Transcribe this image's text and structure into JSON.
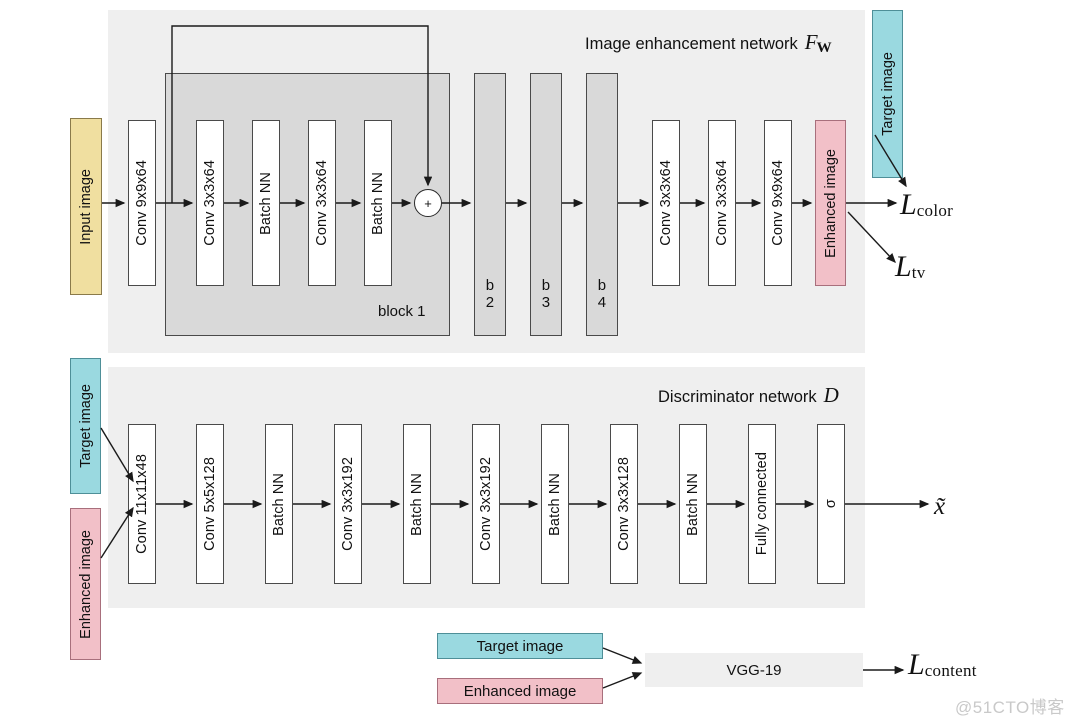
{
  "figure": {
    "enhancement_caption": "Image enhancement network",
    "enhancement_symbol": "F",
    "enhancement_symbol_sub": "W",
    "discriminator_caption": "Discriminator network",
    "discriminator_symbol": "D",
    "block1_label": "block 1"
  },
  "io": {
    "input_image": "Input image",
    "target_image": "Target image",
    "enhanced_image": "Enhanced image",
    "target_image_top": "Target image",
    "target_image_disc": "Target image",
    "enhanced_image_disc": "Enhanced image",
    "target_image_vgg": "Target image",
    "enhanced_image_vgg": "Enhanced image"
  },
  "enhancement_layers": [
    {
      "label": "Conv 9x9x64",
      "kind": "white"
    },
    {
      "label": "Conv 3x3x64",
      "kind": "white"
    },
    {
      "label": "Batch NN",
      "kind": "white"
    },
    {
      "label": "Conv 3x3x64",
      "kind": "white"
    },
    {
      "label": "Batch NN",
      "kind": "white"
    },
    {
      "label": "Conv 3x3x64",
      "kind": "white"
    },
    {
      "label": "Conv 3x3x64",
      "kind": "white"
    },
    {
      "label": "Conv 9x9x64",
      "kind": "white"
    }
  ],
  "residual_blocks": [
    {
      "top": "b",
      "bottom": "2"
    },
    {
      "top": "b",
      "bottom": "3"
    },
    {
      "top": "b",
      "bottom": "4"
    }
  ],
  "adder": {
    "symbol": "+"
  },
  "discriminator_layers": [
    {
      "label": "Conv 11x11x48"
    },
    {
      "label": "Conv 5x5x128"
    },
    {
      "label": "Batch NN"
    },
    {
      "label": "Conv 3x3x192"
    },
    {
      "label": "Batch NN"
    },
    {
      "label": "Conv 3x3x192"
    },
    {
      "label": "Batch NN"
    },
    {
      "label": "Conv 3x3x128"
    },
    {
      "label": "Batch NN"
    },
    {
      "label": "Fully connected"
    },
    {
      "label": "σ"
    }
  ],
  "losses": {
    "color": {
      "symbol": "L",
      "sub": "color"
    },
    "tv": {
      "symbol": "L",
      "sub": "tv"
    },
    "content": {
      "symbol": "L",
      "sub": "content"
    }
  },
  "discriminator_output": "x̃",
  "vgg": {
    "label": "VGG-19"
  },
  "watermark": "@51CTO博客",
  "colors": {
    "panel_bg": "#efefef",
    "block_bg": "#d9d9d9",
    "input": "#f0dfa0",
    "target": "#9ad9e0",
    "enhanced": "#f2c0c8",
    "stroke": "#4a4a4a"
  }
}
